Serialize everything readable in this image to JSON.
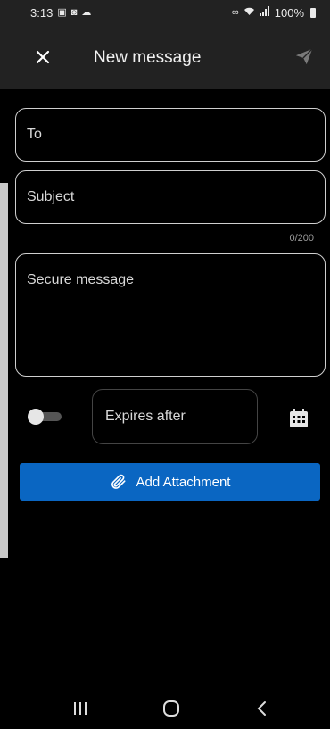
{
  "status_bar": {
    "time": "3:13",
    "battery": "100%",
    "icons": [
      "image-icon",
      "shield-icon",
      "cloud-icon",
      "link-icon",
      "wifi-icon",
      "signal-icon",
      "battery-icon"
    ]
  },
  "header": {
    "title": "New message",
    "close_icon": "close-icon",
    "send_icon": "send-icon"
  },
  "form": {
    "to": {
      "placeholder": "To",
      "value": ""
    },
    "subject": {
      "placeholder": "Subject",
      "value": "",
      "counter": "0/200"
    },
    "message": {
      "placeholder": "Secure message",
      "value": ""
    },
    "expires": {
      "placeholder": "Expires after",
      "toggle_on": false,
      "calendar_icon": "calendar-icon"
    },
    "attach_label": "Add Attachment",
    "attach_icon": "paperclip-icon"
  },
  "nav": {
    "recent_icon": "recent-apps-icon",
    "home_icon": "home-icon",
    "back_icon": "back-icon"
  },
  "colors": {
    "background": "#000000",
    "app_bar": "#222222",
    "accent": "#0a66c2",
    "field_border": "#cfcfcf"
  }
}
